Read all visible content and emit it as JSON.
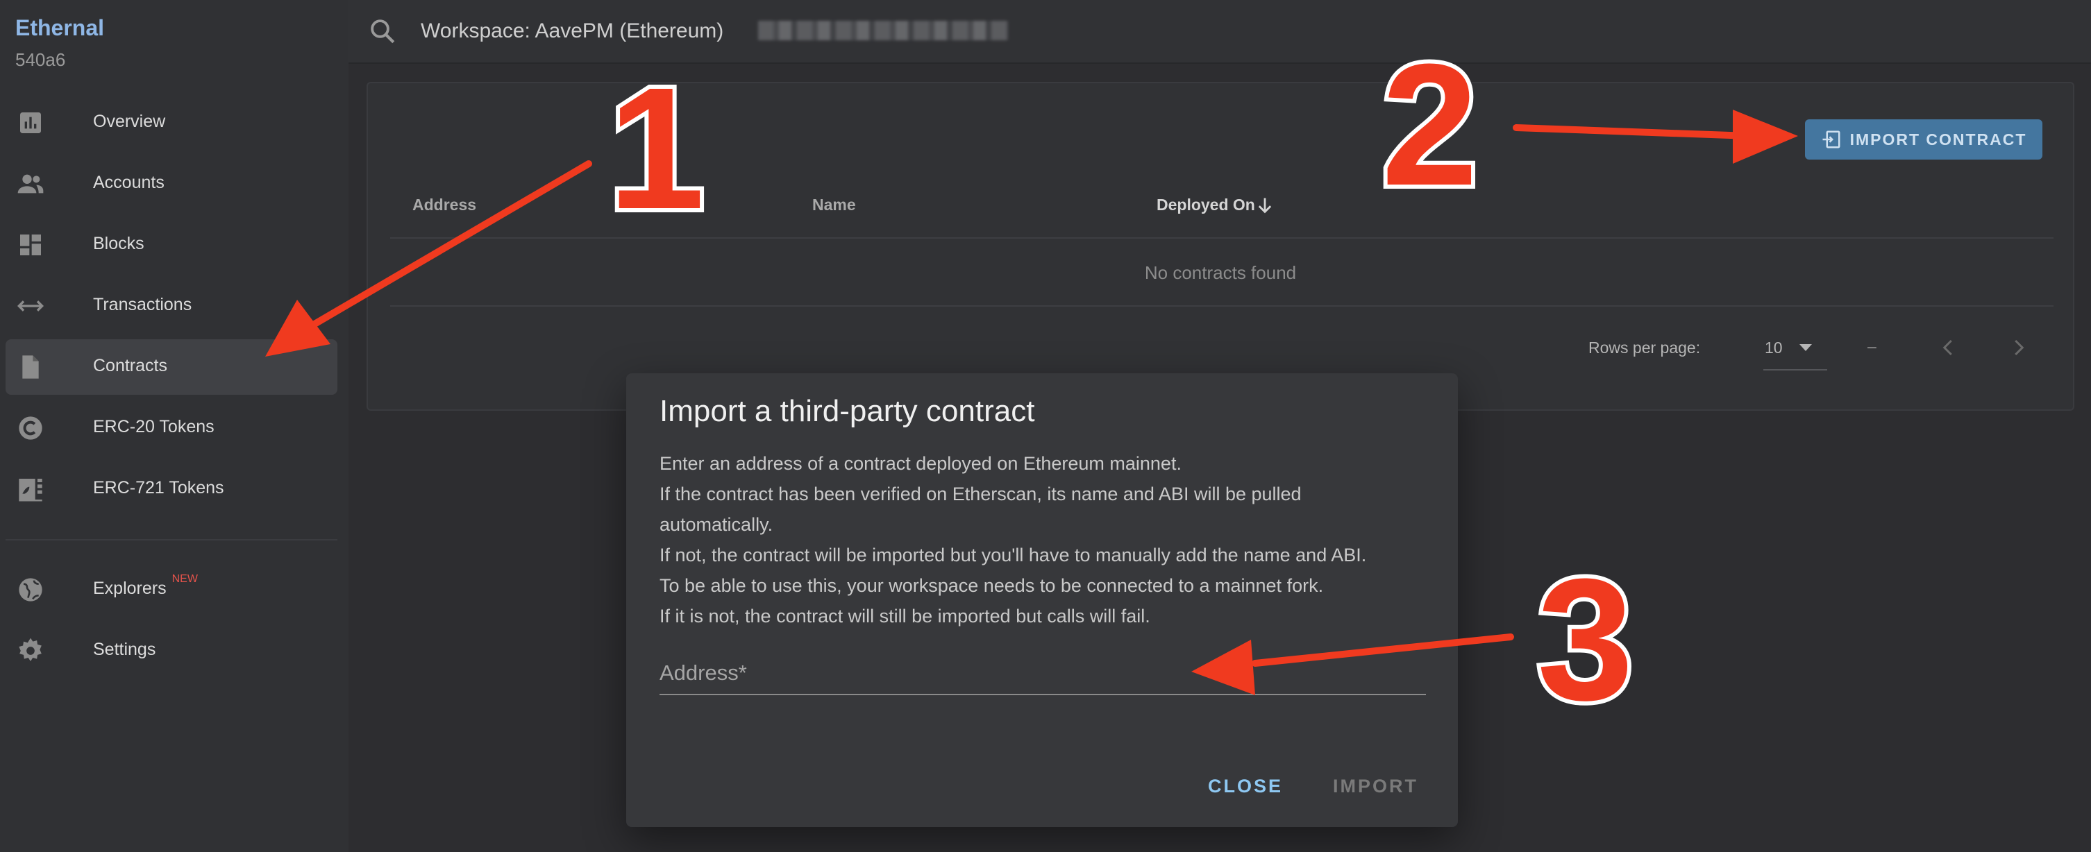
{
  "brand": {
    "name": "Ethernal",
    "sub": "540a6"
  },
  "sidebar": {
    "items": [
      {
        "label": "Overview",
        "icon": "chart-bar-icon",
        "active": false
      },
      {
        "label": "Accounts",
        "icon": "people-icon",
        "active": false
      },
      {
        "label": "Blocks",
        "icon": "dashboard-icon",
        "active": false
      },
      {
        "label": "Transactions",
        "icon": "swap-arrows-icon",
        "active": false
      },
      {
        "label": "Contracts",
        "icon": "file-icon",
        "active": true
      },
      {
        "label": "ERC-20 Tokens",
        "icon": "coin-c-icon",
        "active": false
      },
      {
        "label": "ERC-721 Tokens",
        "icon": "nft-image-icon",
        "active": false
      }
    ],
    "secondary": [
      {
        "label": "Explorers",
        "badge": "NEW",
        "icon": "globe-icon"
      },
      {
        "label": "Settings",
        "icon": "gear-icon"
      }
    ]
  },
  "topbar": {
    "workspace": "Workspace: AavePM (Ethereum)"
  },
  "contracts": {
    "import_button": "IMPORT CONTRACT",
    "columns": [
      "Address",
      "Name",
      "Deployed On"
    ],
    "empty": "No contracts found",
    "pagination": {
      "rows_per_page_label": "Rows per page:",
      "rows_per_page": "10",
      "range": "–"
    }
  },
  "modal": {
    "title": "Import a third-party contract",
    "lines": [
      "Enter an address of a contract deployed on Ethereum mainnet.",
      "If the contract has been verified on Etherscan, its name and ABI will be pulled",
      "automatically.",
      "If not, the contract will be imported but you'll have to manually add the name and ABI.",
      "To be able to use this, your workspace needs to be connected to a mainnet fork.",
      "If it is not, the contract will still be imported but calls will fail."
    ],
    "address_label": "Address*",
    "close": "CLOSE",
    "import": "IMPORT"
  },
  "annotations": {
    "steps": [
      "1",
      "2",
      "3"
    ],
    "arrow_color": "#f03a1f"
  }
}
